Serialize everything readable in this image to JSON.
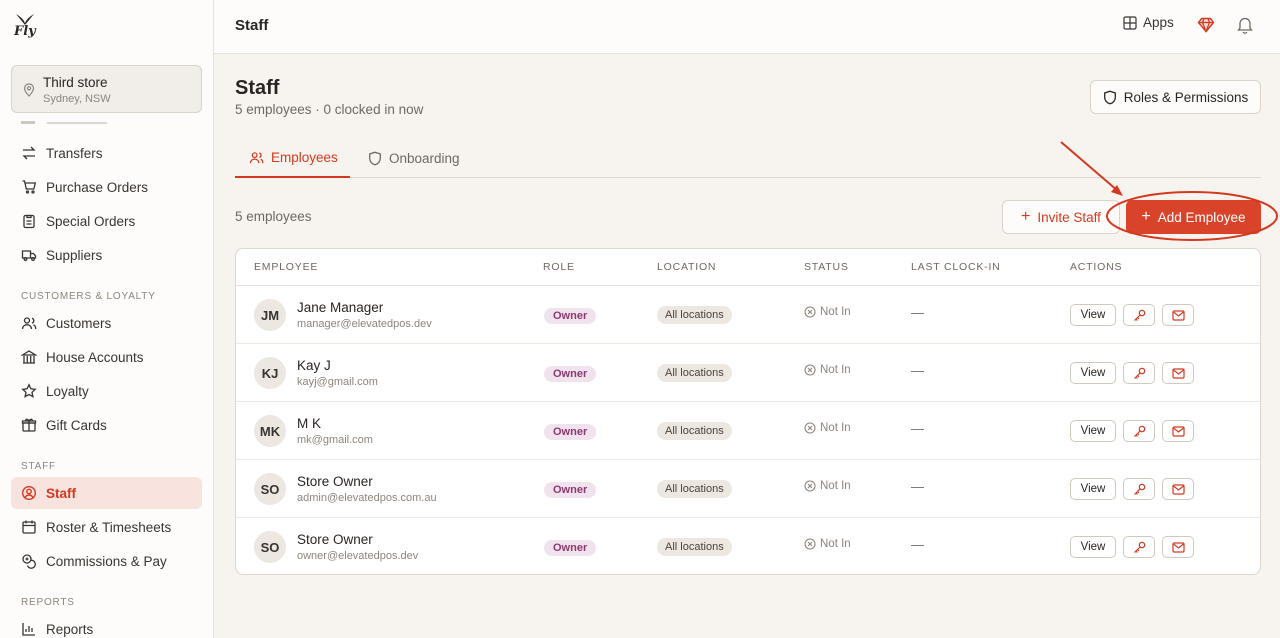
{
  "app": {
    "logo_text": "Fly"
  },
  "store": {
    "name": "Third store",
    "location": "Sydney, NSW"
  },
  "sidebar": {
    "items_top": [
      {
        "label": "Transfers",
        "icon": "transfer-icon"
      },
      {
        "label": "Purchase Orders",
        "icon": "cart-icon"
      },
      {
        "label": "Special Orders",
        "icon": "clipboard-icon"
      },
      {
        "label": "Suppliers",
        "icon": "truck-icon"
      }
    ],
    "section_customers": "CUSTOMERS & LOYALTY",
    "items_customers": [
      {
        "label": "Customers",
        "icon": "users-icon"
      },
      {
        "label": "House Accounts",
        "icon": "building-icon"
      },
      {
        "label": "Loyalty",
        "icon": "star-icon"
      },
      {
        "label": "Gift Cards",
        "icon": "gift-icon"
      }
    ],
    "section_staff": "STAFF",
    "items_staff": [
      {
        "label": "Staff",
        "icon": "user-circle-icon",
        "active": true
      },
      {
        "label": "Roster & Timesheets",
        "icon": "calendar-icon"
      },
      {
        "label": "Commissions & Pay",
        "icon": "coins-icon"
      }
    ],
    "section_reports": "REPORTS",
    "items_reports": [
      {
        "label": "Reports",
        "icon": "bar-chart-icon"
      }
    ]
  },
  "topbar": {
    "title": "Staff",
    "apps_label": "Apps"
  },
  "page": {
    "title": "Staff",
    "subtitle": "5 employees · 0 clocked in now",
    "roles_button": "Roles & Permissions",
    "tabs": [
      {
        "label": "Employees",
        "active": true
      },
      {
        "label": "Onboarding",
        "active": false
      }
    ],
    "count_label": "5 employees",
    "invite_button": "Invite Staff",
    "add_button": "Add Employee"
  },
  "table": {
    "headers": [
      "EMPLOYEE",
      "ROLE",
      "LOCATION",
      "STATUS",
      "LAST CLOCK-IN",
      "ACTIONS"
    ],
    "rows": [
      {
        "initials": "JM",
        "name": "Jane Manager",
        "email": "manager@elevatedpos.dev",
        "role": "Owner",
        "location": "All locations",
        "status": "Not In",
        "last_clock_in": "—",
        "view": "View"
      },
      {
        "initials": "KJ",
        "name": "Kay J",
        "email": "kayj@gmail.com",
        "role": "Owner",
        "location": "All locations",
        "status": "Not In",
        "last_clock_in": "—",
        "view": "View"
      },
      {
        "initials": "MK",
        "name": "M K",
        "email": "mk@gmail.com",
        "role": "Owner",
        "location": "All locations",
        "status": "Not In",
        "last_clock_in": "—",
        "view": "View"
      },
      {
        "initials": "SO",
        "name": "Store Owner",
        "email": "admin@elevatedpos.com.au",
        "role": "Owner",
        "location": "All locations",
        "status": "Not In",
        "last_clock_in": "—",
        "view": "View"
      },
      {
        "initials": "SO",
        "name": "Store Owner",
        "email": "owner@elevatedpos.dev",
        "role": "Owner",
        "location": "All locations",
        "status": "Not In",
        "last_clock_in": "—",
        "view": "View"
      }
    ]
  },
  "colors": {
    "accent": "#d9432a",
    "annotation": "#d4391f"
  }
}
